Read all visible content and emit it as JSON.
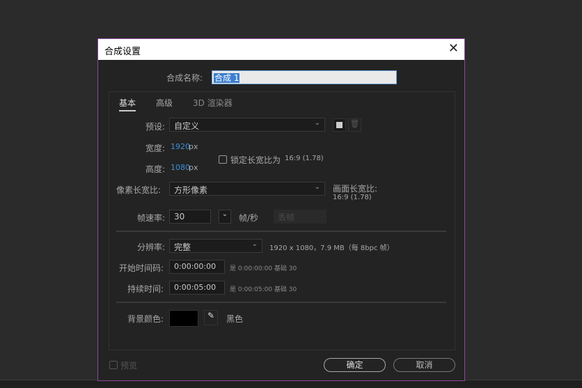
{
  "dialog": {
    "title": "合成设置",
    "close": "✕"
  },
  "name": {
    "label": "合成名称:",
    "value": "合成 1"
  },
  "tabs": [
    {
      "label": "基本"
    },
    {
      "label": "高级"
    },
    {
      "label": "3D 渲染器"
    }
  ],
  "preset": {
    "label": "预设:",
    "value": "自定义"
  },
  "width": {
    "label": "宽度:",
    "value": "1920",
    "unit": "px"
  },
  "height": {
    "label": "高度:",
    "value": "1080",
    "unit": "px"
  },
  "lock": {
    "label": "锁定长宽比为",
    "ratio": "16:9 (1.78)",
    "checked": false
  },
  "pixel_aspect": {
    "label": "像素长宽比:",
    "value": "方形像素"
  },
  "frame_aspect": {
    "label": "画面长宽比:",
    "value": "16:9 (1.78)"
  },
  "frame_rate": {
    "label": "帧速率:",
    "value": "30",
    "unit": "帧/秒",
    "drop": "丢帧"
  },
  "resolution": {
    "label": "分辨率:",
    "value": "完整",
    "info": "1920 x 1080，7.9 MB（每 8bpc 帧）"
  },
  "start": {
    "label": "开始时间码:",
    "value": "0:00:00:00",
    "info": "是 0:00:00:00  基础 30"
  },
  "duration": {
    "label": "持续时间:",
    "value": "0:00:05:00",
    "info": "是 0:00:05:00  基础 30"
  },
  "bg": {
    "label": "背景颜色:",
    "name": "黑色",
    "color": "#000000"
  },
  "footer": {
    "preview": "预览",
    "ok": "确定",
    "cancel": "取消"
  }
}
